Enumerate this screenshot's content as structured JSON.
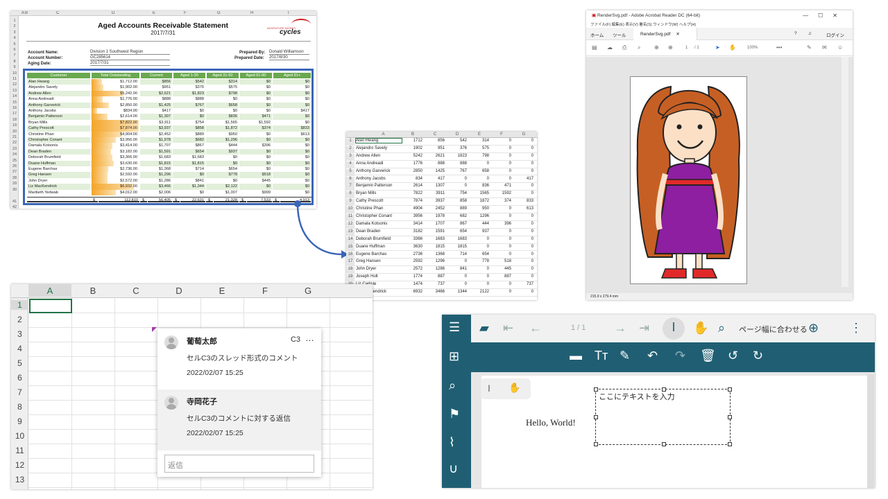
{
  "aged": {
    "col_headers": [
      "A",
      "B",
      "C",
      "D",
      "E",
      "F",
      "G",
      "H",
      "I"
    ],
    "title": "Aged Accounts Receivable Statement",
    "date": "2017/7/31",
    "logo_small": "ADVENTURE WORKS",
    "logo_main": "cycles",
    "labels": {
      "account_name": "Account Name:",
      "account_number": "Account Number:",
      "aging_date": "Aging Date:",
      "prepared_by": "Prepared By:",
      "prepared_date": "Prepared Date:"
    },
    "values": {
      "account_name": "Division 1 Southwest Region",
      "account_number": "GC285614",
      "aging_date": "2017/7/31",
      "prepared_by": "Donald Williamson",
      "prepared_date": "2017/8/30"
    },
    "headers": [
      "Customer",
      "Total Outstanding",
      "Current",
      "Aged 1-30",
      "Aged 31-60",
      "Aged 61-90",
      "Aged 91+"
    ],
    "rows": [
      [
        "Alan Hwang",
        "$1,712.00",
        "$856",
        "$542",
        "$314",
        "$0",
        "$0",
        0.22
      ],
      [
        "Alejandro Savely",
        "$1,902.00",
        "$951",
        "$376",
        "$575",
        "$0",
        "$0",
        0.24
      ],
      [
        "Andrew Allen",
        "$5,242.00",
        "$2,621",
        "$1,823",
        "$798",
        "$0",
        "$0",
        0.66
      ],
      [
        "Anna Andreadi",
        "$1,776.00",
        "$888",
        "$888",
        "$0",
        "$0",
        "$0",
        0.23
      ],
      [
        "Anthony Garverick",
        "$2,850.00",
        "$1,425",
        "$767",
        "$658",
        "$0",
        "$0",
        0.36
      ],
      [
        "Anthony Jacobs",
        "$834.00",
        "$417",
        "$0",
        "$0",
        "$0",
        "$417",
        0.11
      ],
      [
        "Benjamin Patterson",
        "$2,614.00",
        "$1,307",
        "$0",
        "$836",
        "$471",
        "$0",
        0.33
      ],
      [
        "Bryan Mills",
        "$7,822.00",
        "$3,911",
        "$754",
        "$1,565",
        "$1,592",
        "$0",
        0.99
      ],
      [
        "Cathy Prescott",
        "$7,874.00",
        "$3,937",
        "$858",
        "$1,872",
        "$374",
        "$833",
        1.0
      ],
      [
        "Christine Phan",
        "$4,904.00",
        "$2,452",
        "$889",
        "$950",
        "$0",
        "$613",
        0.62
      ],
      [
        "Christopher Conant",
        "$3,956.00",
        "$1,978",
        "$682",
        "$1,296",
        "$0",
        "$0",
        0.5
      ],
      [
        "Damala Kotsonis",
        "$3,414.00",
        "$1,707",
        "$867",
        "$444",
        "$396",
        "$0",
        0.43
      ],
      [
        "Dean Braden",
        "$3,182.00",
        "$1,591",
        "$654",
        "$937",
        "$0",
        "$0",
        0.4
      ],
      [
        "Deborah Brumfield",
        "$3,366.00",
        "$1,683",
        "$1,683",
        "$0",
        "$0",
        "$0",
        0.43
      ],
      [
        "Duane Huffman",
        "$3,630.00",
        "$1,815",
        "$1,815",
        "$0",
        "$0",
        "$0",
        0.46
      ],
      [
        "Eugene Barchas",
        "$2,736.00",
        "$1,368",
        "$714",
        "$654",
        "$0",
        "$0",
        0.35
      ],
      [
        "Greg Hansen",
        "$2,592.00",
        "$1,296",
        "$0",
        "$778",
        "$518",
        "$0",
        0.33
      ],
      [
        "John Dryer",
        "$2,572.00",
        "$1,286",
        "$841",
        "$0",
        "$445",
        "$0",
        0.33
      ],
      [
        "Liz MacKendrick",
        "$6,932.00",
        "$3,466",
        "$1,344",
        "$2,122",
        "$0",
        "$0",
        0.88
      ],
      [
        "Maribeth Yedwab",
        "$4,012.00",
        "$2,006",
        "$0",
        "$1,007",
        "$999",
        "$0",
        0.51
      ]
    ],
    "row_numbers": [
      "1",
      "2",
      "3",
      "4",
      "5",
      "6",
      "7",
      "8",
      "9",
      "10",
      "11",
      "12",
      "13",
      "14",
      "15",
      "16",
      "17",
      "18",
      "19",
      "20",
      "21",
      "22",
      "23",
      "24",
      "25",
      "26",
      "27",
      "28",
      "29",
      "30",
      "41",
      "42"
    ],
    "totals": [
      "$",
      "112,810",
      "$",
      "56,405",
      "$",
      "22,631",
      "$",
      "21,328",
      "$",
      "7,533",
      "$",
      "4,913"
    ]
  },
  "sheet": {
    "col_headers": [
      "A",
      "B",
      "C",
      "D",
      "E",
      "F",
      "G"
    ],
    "rows": [
      [
        "1",
        "Alan Hwang",
        "1712",
        "856",
        "542",
        "314",
        "0",
        "0"
      ],
      [
        "2",
        "Alejandro Savely",
        "1902",
        "951",
        "376",
        "575",
        "0",
        "0"
      ],
      [
        "3",
        "Andrew Allen",
        "5242",
        "2621",
        "1823",
        "798",
        "0",
        "0"
      ],
      [
        "4",
        "Anna Andreadi",
        "1776",
        "888",
        "888",
        "0",
        "0",
        "0"
      ],
      [
        "5",
        "Anthony Garverick",
        "2850",
        "1425",
        "767",
        "658",
        "0",
        "0"
      ],
      [
        "6",
        "Anthony Jacobs",
        "834",
        "417",
        "0",
        "0",
        "0",
        "417"
      ],
      [
        "7",
        "Benjamin Patterson",
        "2614",
        "1307",
        "0",
        "836",
        "471",
        "0"
      ],
      [
        "8",
        "Bryan Mills",
        "7822",
        "3911",
        "754",
        "1565",
        "1592",
        "0"
      ],
      [
        "9",
        "Cathy Prescott",
        "7874",
        "3937",
        "858",
        "1872",
        "374",
        "833"
      ],
      [
        "10",
        "Christine Phan",
        "4904",
        "2452",
        "889",
        "950",
        "0",
        "613"
      ],
      [
        "11",
        "Christopher Conant",
        "3956",
        "1978",
        "682",
        "1296",
        "0",
        "0"
      ],
      [
        "12",
        "Damala Kotsonis",
        "3414",
        "1707",
        "867",
        "444",
        "396",
        "0"
      ],
      [
        "13",
        "Dean Braden",
        "3182",
        "1591",
        "654",
        "937",
        "0",
        "0"
      ],
      [
        "14",
        "Deborah Brumfield",
        "3366",
        "1683",
        "1683",
        "0",
        "0",
        "0"
      ],
      [
        "15",
        "Duane Huffman",
        "3630",
        "1815",
        "1815",
        "0",
        "0",
        "0"
      ],
      [
        "16",
        "Eugene Barchas",
        "2736",
        "1368",
        "714",
        "654",
        "0",
        "0"
      ],
      [
        "17",
        "Greg Hansen",
        "2592",
        "1296",
        "0",
        "778",
        "518",
        "0"
      ],
      [
        "18",
        "John Dryer",
        "2572",
        "1286",
        "841",
        "0",
        "445",
        "0"
      ],
      [
        "19",
        "Joseph Holt",
        "1774",
        "887",
        "0",
        "0",
        "887",
        "0"
      ],
      [
        "20",
        "Liz Carlisle",
        "1474",
        "737",
        "0",
        "0",
        "0",
        "737"
      ],
      [
        "21",
        "Liz MacKendrick",
        "6932",
        "3466",
        "1344",
        "2122",
        "0",
        "0"
      ]
    ]
  },
  "acrobat": {
    "window_title": "RenderSvg.pdf - Adobe Acrobat Reader DC (64-bit)",
    "menu": "ファイル(F)  編集(E)  表示(V)  署名(S)  ウィンドウ(W)  ヘルプ(H)",
    "tab_home": "ホーム",
    "tab_tools": "ツール",
    "tab_doc": "RenderSvg.pdf",
    "login": "ログイン",
    "page_input": "1",
    "page_total": "/ 1",
    "zoom": "100%",
    "page_size": "215.9 x 279.4 mm"
  },
  "comments": {
    "col_headers": [
      "A",
      "B",
      "C",
      "D",
      "E",
      "F",
      "G"
    ],
    "row_headers": [
      "1",
      "2",
      "3",
      "4",
      "5",
      "6",
      "7",
      "8",
      "9",
      "10",
      "11",
      "12",
      "13"
    ],
    "author1": "葡萄太郎",
    "cell_ref": "C3",
    "more": "…",
    "text1": "セルC3のスレッド形式のコメント",
    "time1": "2022/02/07 15:25",
    "author2": "寺岡花子",
    "text2": "セルC3のコメントに対する返信",
    "time2": "2022/02/07 15:25",
    "reply_placeholder": "返信"
  },
  "pdfviewer": {
    "page_indicator": "1 / 1",
    "fit_label": "ページ幅に合わせる",
    "hello": "Hello, World!",
    "textbox_placeholder": "ここにテキストを入力",
    "accent": "#205f73"
  }
}
